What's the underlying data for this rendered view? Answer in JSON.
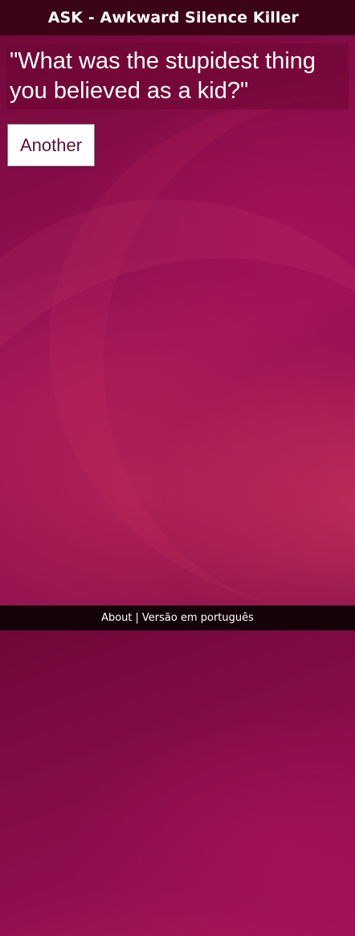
{
  "header": {
    "title": "ASK - Awkward Silence Killer"
  },
  "question": {
    "text": "\"What was the stupidest thing you believed as a kid?\""
  },
  "actions": {
    "another_label": "Another"
  },
  "footer": {
    "about_label": "About",
    "separator": "|",
    "language_label": "Versão em português"
  },
  "colors": {
    "header_bg": "#3c0517",
    "footer_bg": "#14040a",
    "background_primary": "#8a0d4a",
    "button_text": "#5a1236"
  }
}
